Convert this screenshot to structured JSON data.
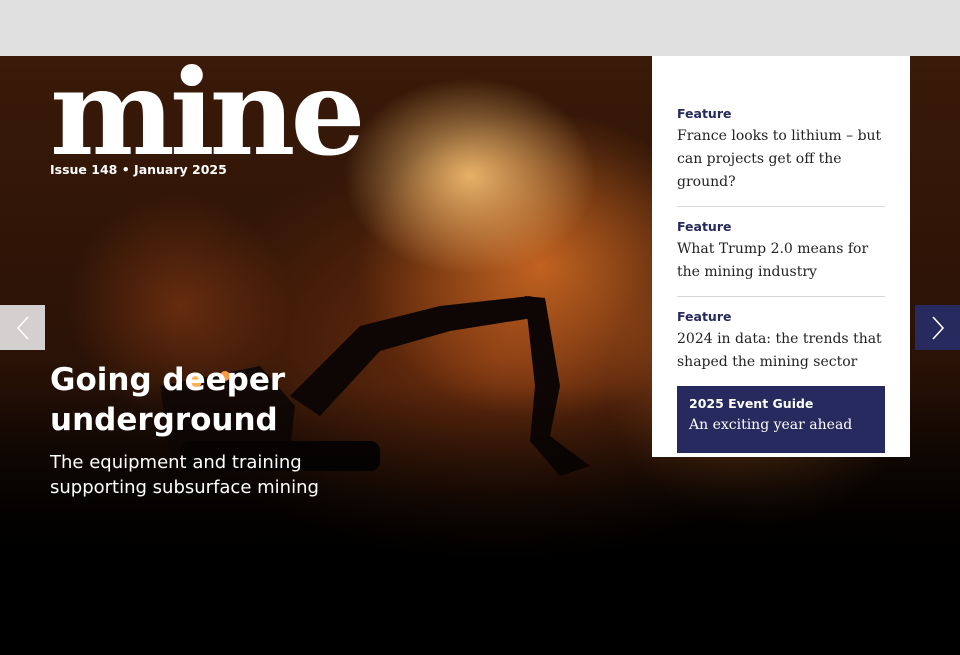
{
  "masthead": {
    "logo_text": "mine",
    "issue": "Issue 148 • January 2025"
  },
  "hero": {
    "headline": "Going deeper underground",
    "subhead": "The equipment and training supporting subsurface mining"
  },
  "side_panel": {
    "items": [
      {
        "kicker": "Feature",
        "title": "France looks to lithium – but can projects get off the ground?"
      },
      {
        "kicker": "Feature",
        "title": "What Trump 2.0 means for the mining industry"
      },
      {
        "kicker": "Feature",
        "title": "2024 in data: the trends that shaped the mining sector"
      }
    ],
    "promo": {
      "title": "2025 Event Guide",
      "text": "An exciting year ahead"
    }
  },
  "controls": {
    "prev_icon": "chevron-left-icon",
    "next_icon": "chevron-right-icon"
  },
  "colors": {
    "brand_navy": "#262a5e",
    "top_bar": "#e0e0e0",
    "panel_bg": "#ffffff"
  }
}
